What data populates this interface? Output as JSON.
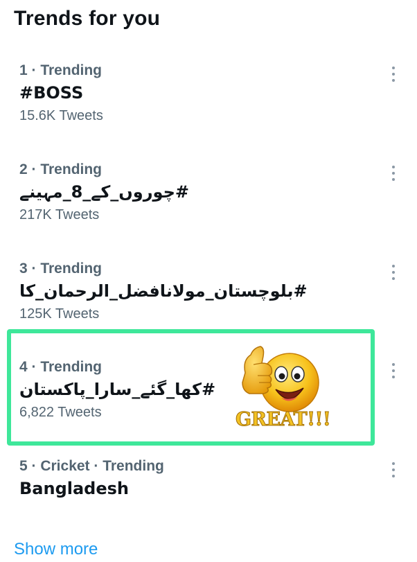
{
  "header": {
    "title": "Trends for you"
  },
  "trends": [
    {
      "meta": "1 · Trending",
      "name": "#BOSS",
      "count": "15.6K Tweets"
    },
    {
      "meta": "2 · Trending",
      "name": "#چوروں_کے_8_مہینے",
      "count": "217K Tweets"
    },
    {
      "meta": "3 · Trending",
      "name": "#بلوچستان_مولانافضل_الرحمان_کا",
      "count": "125K Tweets"
    },
    {
      "meta": "4 · Trending",
      "name": "#کھا_گئے_سارا_پاکستان",
      "count": "6,822 Tweets"
    },
    {
      "meta": "5 · Cricket · Trending",
      "name": "Bangladesh",
      "count": ""
    }
  ],
  "sticker": {
    "text": "GREAT!!!",
    "icon": "thumbs-up-smiley-icon"
  },
  "footer": {
    "show_more": "Show more"
  },
  "colors": {
    "accent": "#1d9bf0",
    "highlight": "#3ee79a",
    "secondary_text": "#536471"
  }
}
